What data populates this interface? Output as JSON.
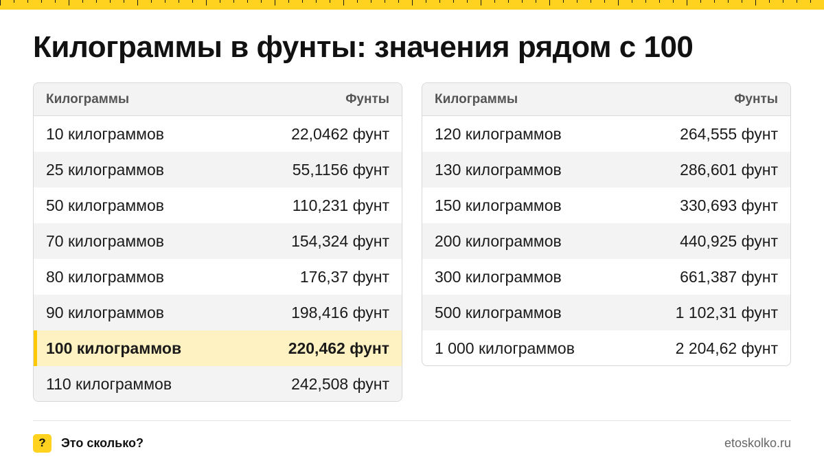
{
  "title": "Килограммы в фунты: значения рядом с 100",
  "colors": {
    "accent": "#ffd21f",
    "highlight_bg": "#fff2c2",
    "highlight_bar": "#ffc800"
  },
  "tables": [
    {
      "headers": [
        "Килограммы",
        "Фунты"
      ],
      "rows": [
        {
          "kg": "10 килограммов",
          "lb": "22,0462 фунт"
        },
        {
          "kg": "25 килограммов",
          "lb": "55,1156 фунт"
        },
        {
          "kg": "50 килограммов",
          "lb": "110,231 фунт"
        },
        {
          "kg": "70 килограммов",
          "lb": "154,324 фунт"
        },
        {
          "kg": "80 килограммов",
          "lb": "176,37 фунт"
        },
        {
          "kg": "90 килограммов",
          "lb": "198,416 фунт"
        },
        {
          "kg": "100 килограммов",
          "lb": "220,462 фунт",
          "highlighted": true
        },
        {
          "kg": "110 килограммов",
          "lb": "242,508 фунт"
        }
      ]
    },
    {
      "headers": [
        "Килограммы",
        "Фунты"
      ],
      "rows": [
        {
          "kg": "120 килограммов",
          "lb": "264,555 фунт"
        },
        {
          "kg": "130 килограммов",
          "lb": "286,601 фунт"
        },
        {
          "kg": "150 килограммов",
          "lb": "330,693 фунт"
        },
        {
          "kg": "200 килограммов",
          "lb": "440,925 фунт"
        },
        {
          "kg": "300 килограммов",
          "lb": "661,387 фунт"
        },
        {
          "kg": "500 килограммов",
          "lb": "1 102,31 фунт"
        },
        {
          "kg": "1 000 килограммов",
          "lb": "2 204,62 фунт"
        }
      ]
    }
  ],
  "footer": {
    "badge_icon": "question-mark-icon",
    "badge_symbol": "?",
    "brand": "Это сколько?",
    "site": "etoskolko.ru"
  }
}
